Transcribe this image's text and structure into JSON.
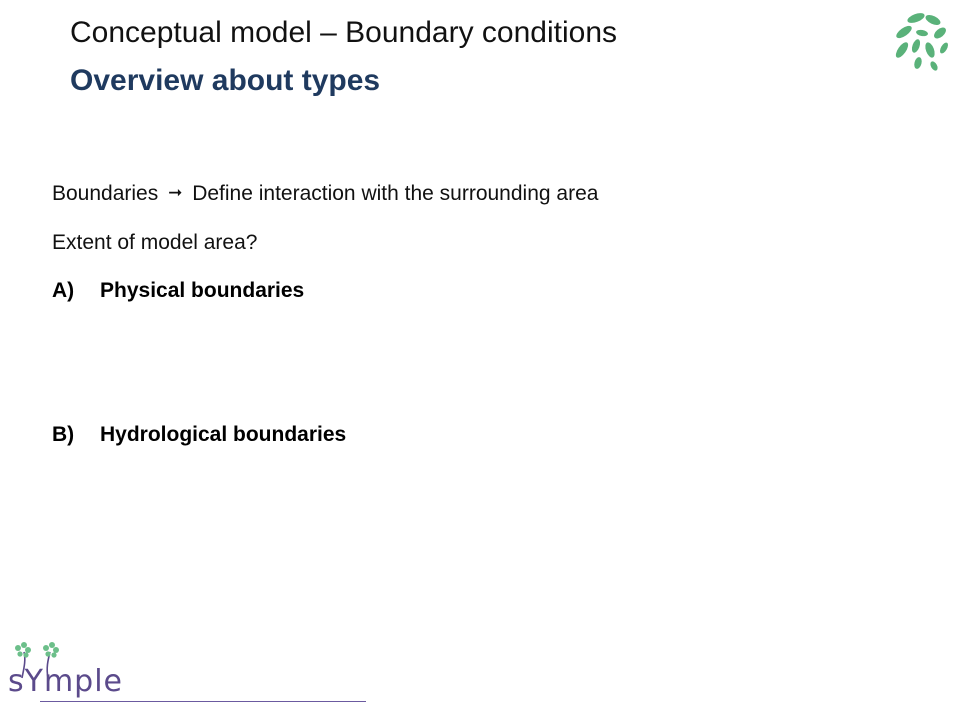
{
  "slide": {
    "title": "Conceptual model – Boundary conditions",
    "subtitle": "Overview about types",
    "line1_left": "Boundaries",
    "line1_right": "Define interaction with the surrounding area",
    "line2": "Extent of model area?",
    "items": [
      {
        "marker": "A)",
        "label": "Physical boundaries"
      },
      {
        "marker": "B)",
        "label": "Hydrological boundaries"
      }
    ]
  },
  "logos": {
    "top_right": "leaf-cluster-icon",
    "bottom_left_text": "sYmple"
  },
  "colors": {
    "title": "#111111",
    "subtitle": "#1f3a5f",
    "leaf_green": "#5ab27a",
    "symple_purple": "#5b4a8b"
  }
}
